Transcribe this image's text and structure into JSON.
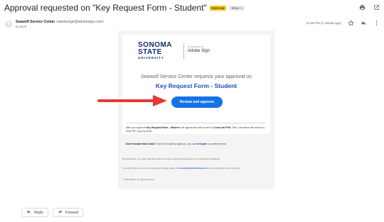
{
  "subject": {
    "text": "Approval requested on \"Key Request Form - Student\"",
    "badge_external": "External",
    "badge_inbox": "Inbox",
    "badge_inbox_close": "x"
  },
  "top_icons": [
    "print-icon",
    "open-in-new-window-icon"
  ],
  "sender": {
    "name": "Seawolf Service Center",
    "email": "<adobesign@adobesign.com>",
    "to_line": "to me",
    "timestamp": "12:48 PM (1 minute ago)"
  },
  "email_body": {
    "logo": {
      "line1": "SONOMA",
      "line2": "STATE",
      "line3": "UNIVERSITY",
      "powered_by": "POWERED BY",
      "product": "Adobe Sign"
    },
    "request_line": "Seawolf Service Center requests your approval on",
    "form_title": "Key Request Form - Student",
    "button_label": "Review and approve",
    "after_text": {
      "prefix": "After you approve ",
      "form": "Key Request Form - Student",
      "middle": ", the agreement will be sent to ",
      "person": "Linus van Pelt",
      "suffix": ". Then, all parties will receive a final PDF copy by email."
    },
    "dont_forward": {
      "bold": "Don't forward this email:",
      "text": " If you don't want to approve, you can ",
      "link": "delegate",
      "suffix": " to someone else."
    },
    "footer": {
      "proceeding": "By proceeding, you agree that this agreement may be signed using electronic or handwritten signatures.",
      "ensure_prefix": "To ensure that you continue receiving our emails, please add ",
      "ensure_email": "adobesign@adobesign.com",
      "ensure_suffix": " to your address book or safe list.",
      "copyright": "© 2021 Adobe. All rights reserved."
    }
  },
  "actions": {
    "reply": "Reply",
    "forward": "Forward"
  },
  "colors": {
    "accent": "#1473e6",
    "link": "#1b4fbf",
    "external_badge": "#f0c419",
    "arrow": "#e53935",
    "brand": "#0e2d6e"
  }
}
